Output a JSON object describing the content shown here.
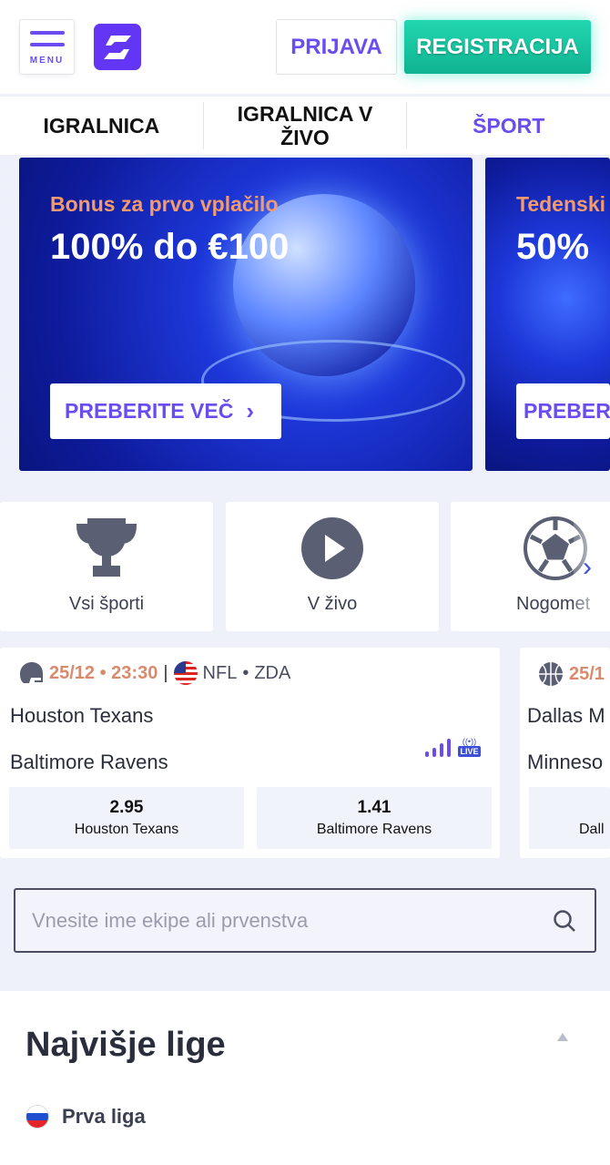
{
  "header": {
    "menu_label": "MENU",
    "login": "PRIJAVA",
    "register": "REGISTRACIJA",
    "accent": "#6a4cf0",
    "register_color": "#17c6a0"
  },
  "tabs": [
    {
      "label": "IGRALNICA"
    },
    {
      "label": "IGRALNICA V ŽIVO"
    },
    {
      "label": "ŠPORT",
      "active": true
    }
  ],
  "banners": [
    {
      "subtitle": "Bonus za prvo vplačilo",
      "title": "100% do €100",
      "cta": "PREBERITE VEČ"
    },
    {
      "subtitle": "Tedenski",
      "title": "50%",
      "cta": "PREBER"
    }
  ],
  "categories": [
    {
      "label": "Vsi športi",
      "icon": "trophy-icon"
    },
    {
      "label": "V živo",
      "icon": "play-icon"
    },
    {
      "label": "Nogomet",
      "icon": "soccer-ball-icon"
    }
  ],
  "matches": [
    {
      "sport_icon": "american-football-helmet-icon",
      "datetime": "25/12 • 23:30",
      "league": "NFL",
      "country": "ZDA",
      "home": "Houston Texans",
      "away": "Baltimore Ravens",
      "live": "LIVE",
      "odds": [
        {
          "value": "2.95",
          "label": "Houston Texans"
        },
        {
          "value": "1.41",
          "label": "Baltimore Ravens"
        }
      ]
    },
    {
      "sport_icon": "basketball-icon",
      "datetime": "25/1",
      "home": "Dallas M",
      "away": "Minneso",
      "odds": [
        {
          "label": "Dall"
        }
      ]
    }
  ],
  "search": {
    "placeholder": "Vnesite ime ekipe ali prvenstva"
  },
  "top_leagues": {
    "title": "Najvišje lige",
    "items": [
      {
        "label": "Prva liga",
        "flag": "slovenia-flag"
      }
    ]
  }
}
